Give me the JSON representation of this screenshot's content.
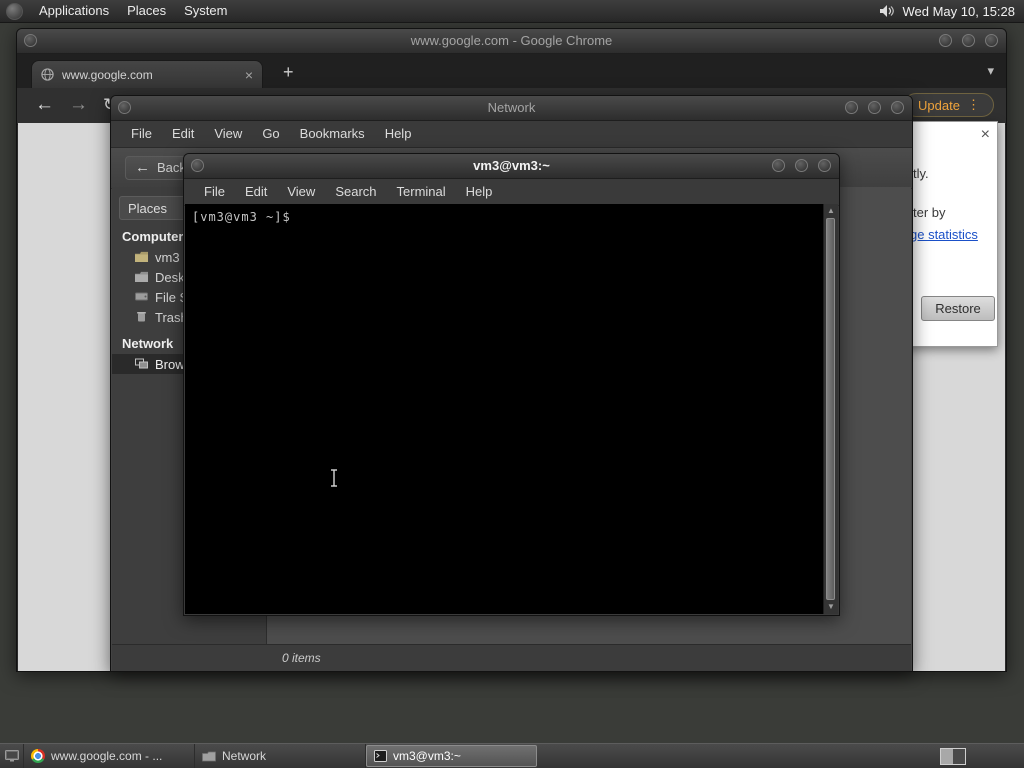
{
  "panel": {
    "menus": [
      "Applications",
      "Places",
      "System"
    ],
    "clock": "Wed May 10, 15:28"
  },
  "icons": {
    "close": "×",
    "new_tab": "+",
    "overflow_chevron": "▾",
    "back_arrow": "←",
    "forward_arrow": "→",
    "reload": "↻",
    "menu_dots": "⋮",
    "combo_arrow": "▾",
    "scroll_up": "▲",
    "scroll_down": "▼",
    "toolbar_back_arrow": "←"
  },
  "chrome": {
    "title": "www.google.com - Google Chrome",
    "tab_label": "www.google.com",
    "update_label": "Update",
    "bubble": {
      "text_line1": "tly.",
      "text_line2": "ter by",
      "link_text": "ge statistics",
      "restore_label": "Restore"
    }
  },
  "network": {
    "title": "Network",
    "menus": [
      "File",
      "Edit",
      "View",
      "Go",
      "Bookmarks",
      "Help"
    ],
    "back_label": "Back",
    "places_label": "Places",
    "sidebar": {
      "computer_header": "Computer",
      "items": [
        "vm3",
        "Desktop",
        "File System",
        "Trash"
      ],
      "network_header": "Network",
      "browse_label": "Browse Network"
    },
    "status": "0 items"
  },
  "terminal": {
    "title": "vm3@vm3:~",
    "menus": [
      "File",
      "Edit",
      "View",
      "Search",
      "Terminal",
      "Help"
    ],
    "prompt": "[vm3@vm3 ~]$"
  },
  "taskbar": {
    "items": [
      "www.google.com - ...",
      "Network",
      "vm3@vm3:~"
    ]
  }
}
